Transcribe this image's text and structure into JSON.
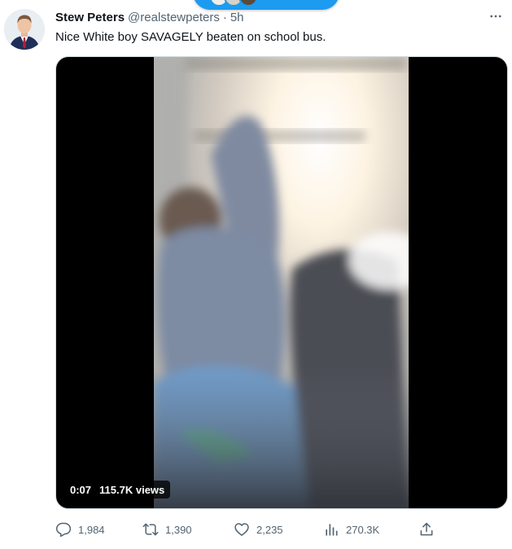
{
  "tweet": {
    "author_name": "Stew Peters",
    "author_handle": "@realstewpeters",
    "separator": "·",
    "timestamp": "5h",
    "text": "Nice White boy SAVAGELY beaten on school bus."
  },
  "video": {
    "duration": "0:07",
    "views": "115.7K views"
  },
  "actions": {
    "replies": "1,984",
    "reposts": "1,390",
    "likes": "2,235",
    "views": "270.3K"
  },
  "icons": {
    "more": "more-horizontal-icon",
    "reply": "reply-icon",
    "repost": "repost-icon",
    "like": "heart-icon",
    "views": "analytics-icon",
    "share": "share-icon"
  },
  "colors": {
    "accent": "#1d9bf0",
    "text_primary": "#0f1419",
    "text_secondary": "#536471"
  }
}
